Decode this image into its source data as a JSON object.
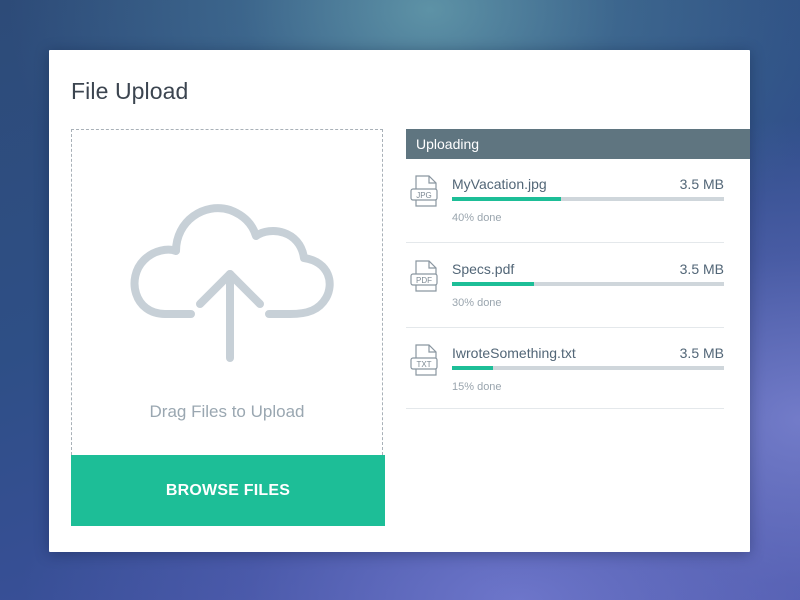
{
  "title": "File Upload",
  "dropzone": {
    "label": "Drag Files to Upload",
    "icon": "cloud-upload-icon"
  },
  "browse_button": {
    "label": "BROWSE FILES",
    "color": "#1dbe97"
  },
  "uploading": {
    "header": "Uploading",
    "header_color": "#5f7580",
    "files": [
      {
        "name": "MyVacation.jpg",
        "size": "3.5 MB",
        "status": "40% done",
        "progress": 0.4,
        "icon_label": "JPG",
        "icon": "jpg-file-icon"
      },
      {
        "name": "Specs.pdf",
        "size": "3.5 MB",
        "status": "30% done",
        "progress": 0.3,
        "icon_label": "PDF",
        "icon": "pdf-file-icon"
      },
      {
        "name": "IwroteSomething.txt",
        "size": "3.5 MB",
        "status": "15% done",
        "progress": 0.15,
        "icon_label": "TXT",
        "icon": "txt-file-icon"
      }
    ]
  },
  "colors": {
    "accent": "#1dbe97",
    "text": "#526677",
    "muted": "#9aa5ae"
  }
}
